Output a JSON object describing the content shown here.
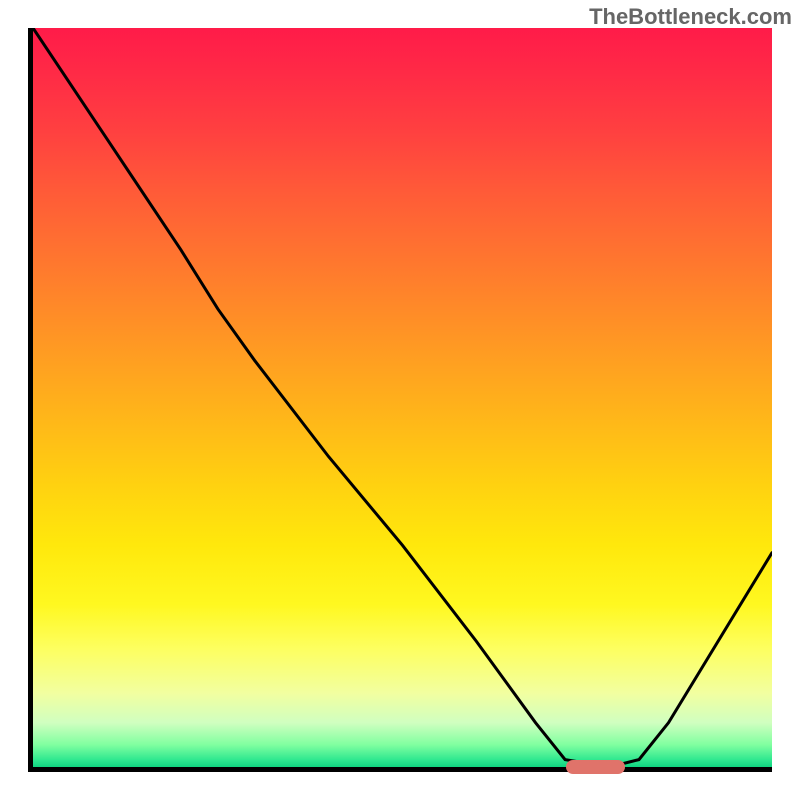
{
  "watermark": "TheBottleneck.com",
  "chart_data": {
    "type": "line",
    "title": "",
    "xlabel": "",
    "ylabel": "",
    "xlim": [
      0,
      100
    ],
    "ylim": [
      0,
      100
    ],
    "series": [
      {
        "name": "curve",
        "x": [
          0,
          10,
          20,
          25,
          30,
          40,
          50,
          60,
          68,
          72,
          78,
          82,
          86,
          100
        ],
        "y": [
          100,
          85,
          70,
          62,
          55,
          42,
          30,
          17,
          6,
          1,
          0,
          1,
          6,
          29
        ]
      }
    ],
    "valley_marker": {
      "x_start": 72,
      "x_end": 80,
      "y": 0
    },
    "gradient_colors": {
      "top": "#ff1b49",
      "bottom": "#10d480"
    }
  }
}
